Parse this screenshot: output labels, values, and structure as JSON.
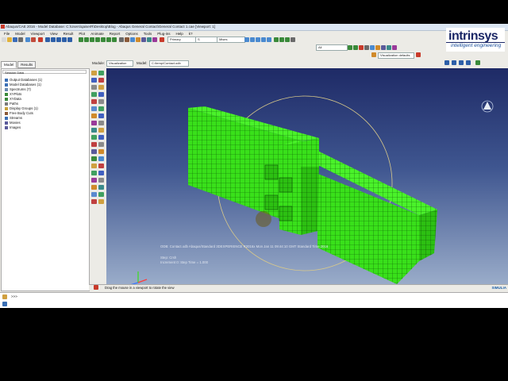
{
  "window": {
    "title": "Abaqus/CAE 2016 - Model Database: C:\\Users\\qaiserR\\Desktop\\Blog - Abaqus General Contact\\General Contact 1.cae [Viewport: 1]"
  },
  "menu": [
    "File",
    "Model",
    "Viewport",
    "View",
    "Result",
    "Plot",
    "Animate",
    "Report",
    "Options",
    "Tools",
    "Plug-ins",
    "Help",
    "k?"
  ],
  "toolbar": {
    "field_primary": "Primary",
    "field_step": "S",
    "field_invariant": "Mises",
    "field_all": "All",
    "visualization_defaults": "Visualization defaults"
  },
  "module_bar": {
    "module_label": "Module:",
    "module_value": "Visualization",
    "model_label": "Model:",
    "model_value": "C:/temp/Contact.odb"
  },
  "tabs": [
    "Model",
    "Results"
  ],
  "tree": {
    "session_label": "Session Data",
    "items": [
      {
        "label": "Output Databases (1)",
        "color": "#3a6fb5"
      },
      {
        "label": "Model Databases (1)",
        "color": "#3a6fb5"
      },
      {
        "label": "Spectrums (7)",
        "color": "#6a8ab0"
      },
      {
        "label": "XYPlots",
        "color": "#3a8a3a"
      },
      {
        "label": "XYData",
        "color": "#3a8a3a"
      },
      {
        "label": "Paths",
        "color": "#7a7a7a"
      },
      {
        "label": "Display Groups (1)",
        "color": "#c8a23a"
      },
      {
        "label": "Free Body Cuts",
        "color": "#8a5a3a"
      },
      {
        "label": "Streams",
        "color": "#3a6fb5"
      },
      {
        "label": "Movies",
        "color": "#5a5a9a"
      },
      {
        "label": "Images",
        "color": "#5a5a9a"
      }
    ]
  },
  "viewport": {
    "odb_line": "ODB: Contact.odb     Abaqus/Standard 3DEXPERIENCE R2016x     Mon Jan 11 09:44:10 GMT Standard Time 2016",
    "step_line": "Step: Crsh",
    "increment_line": "Increment      0: Step Time =      1.000",
    "mesh_color": "#39e01a",
    "background_top": "#1e2a66",
    "background_bottom": "#9eb0cc"
  },
  "hint": {
    "text": "Drag the mouse in a viewport to rotate the view",
    "brand": "SIMULIA"
  },
  "message_area": {
    "prompt": ">>>"
  },
  "logo": {
    "word": "intrinsys",
    "tagline": "intelligent engineering"
  }
}
